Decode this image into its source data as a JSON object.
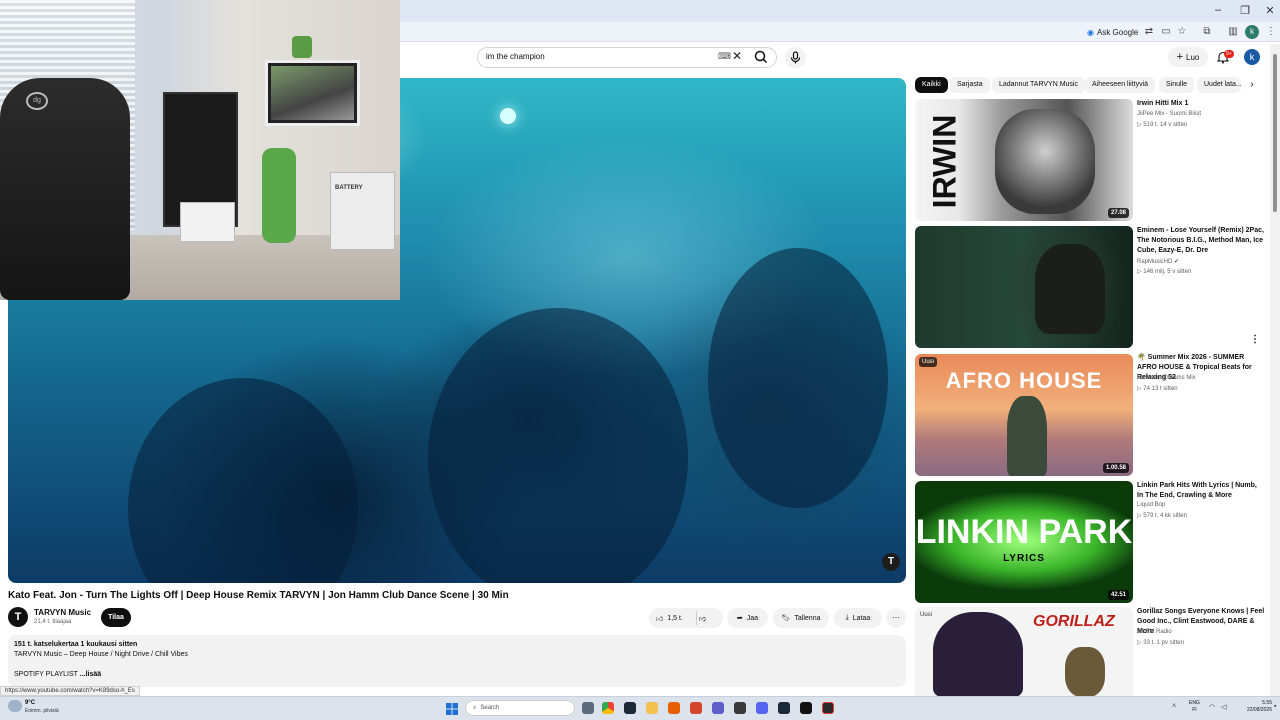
{
  "browser": {
    "ask_google": "Ask Google",
    "profile_letter": "k"
  },
  "header": {
    "search_value": "im the champion",
    "create_label": "Luo",
    "notif_count": "9+",
    "avatar_letter": "k"
  },
  "video": {
    "title": "Kato Feat. Jon - Turn The Lights Off | Deep House Remix TARVYN | Jon Hamm Club Dance Scene | 30 Min",
    "channel_name": "TARVYN Music",
    "channel_subs": "21,4 t. tilaajaa",
    "channel_initial": "T",
    "subscribe_label": "Tilaa",
    "like_count": "1,5 t.",
    "share_label": "Jaa",
    "save_label": "Tallenna",
    "download_label": "Lataa",
    "desc_stats": "151 t. katselukertaa  1 kuukausi sitten",
    "desc_line": "TARVYN Music – Deep House / Night Drive / Chill Vibes",
    "desc_spotify": "SPOTIFY PLAYLIST",
    "desc_more": "...lisää",
    "player_logo": "T"
  },
  "status_url": "https://www.youtube.com/watch?v=K89dso-h_Es",
  "chips": [
    "Kaikki",
    "Sarjasta",
    "Ladannut TARVYN Music",
    "Aiheeseen liittyviä",
    "Sinulle",
    "Uudet lata..."
  ],
  "recommended": [
    {
      "title": "Irwin Hitti Mix 1",
      "channel": "JiiPee Mix - Suomi Biisit",
      "meta": "▷ 519 t.   14 v sitten",
      "duration": "27.08",
      "thumb_text": "IRWIN"
    },
    {
      "title": "Eminem - Lose Yourself (Remix) 2Pac, The Notorious B.I.G., Method Man, Ice Cube, Eazy-E, Dr. Dre",
      "channel": "RapMusicHD",
      "meta": "▷ 146 milj.   5 v sitten",
      "duration": ""
    },
    {
      "title": "🌴 Summer Mix 2026 - SUMMER AFRO HOUSE & Tropical Beats for Relaxing 52",
      "channel": "Saltwater Dreams Mix",
      "meta": "▷ 74   13 t sitten",
      "duration": "1.00.58",
      "badge": "Uusi",
      "thumb_text": "AFRO HOUSE"
    },
    {
      "title": "Linkin Park Hits With Lyrics | Numb, In The End, Crawling & More",
      "channel": "Liquid Bop",
      "meta": "▷ 579 t.   4 kk sitten",
      "duration": "42.51",
      "thumb_text": "LINKIN PARK",
      "thumb_sub": "LYRICS"
    },
    {
      "title": "Gorillaz Songs Everyone Knows | Feel Good Inc., Clint Eastwood, DARE & More",
      "channel": "Alt FM Radio",
      "meta": "▷ 33 t.   1 pv sitten",
      "badge": "Uusi",
      "thumb_text": "GORILLAZ"
    }
  ],
  "webcam": {
    "chair_logo": "dg",
    "battery_label": "BATTERY"
  },
  "taskbar": {
    "temp": "9°C",
    "weather": "Enimm. pilvistä",
    "search_placeholder": "Search",
    "lang_1": "ENG",
    "lang_2": "FI",
    "time": "5.55",
    "date": "22/08/2026"
  },
  "colors": {
    "accent": "#0f0f0f",
    "badge": "#e62117",
    "taskbar": "#dde3ec"
  }
}
